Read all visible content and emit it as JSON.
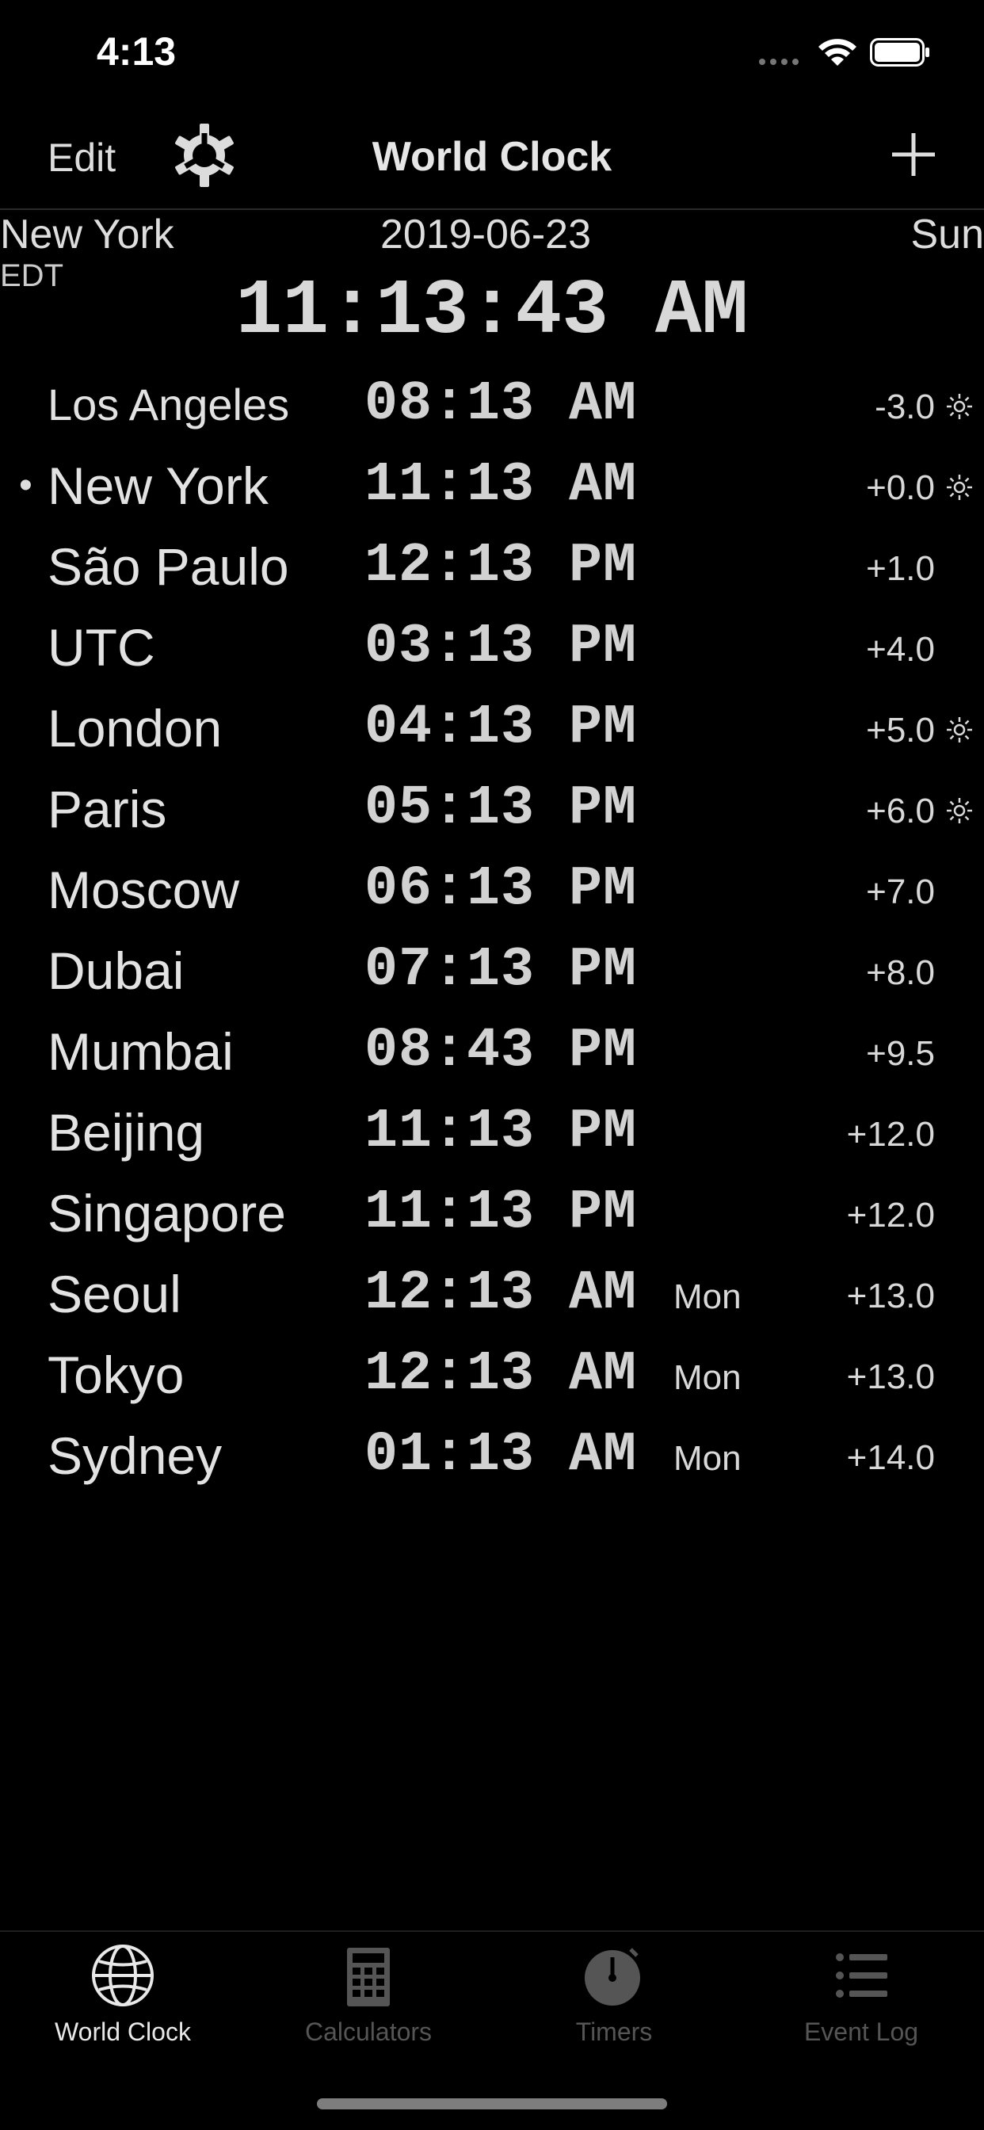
{
  "status_bar": {
    "time": "4:13"
  },
  "nav": {
    "edit_label": "Edit",
    "title": "World Clock",
    "settings_icon": "gear-icon",
    "add_icon": "plus-icon"
  },
  "header": {
    "city": "New York",
    "timezone": "EDT",
    "date": "2019-06-23",
    "day": "Sun",
    "clock": "11:13:43 AM"
  },
  "rows": [
    {
      "city": "Los Angeles",
      "time": "08:13 AM",
      "day": "",
      "offset": "-3.0",
      "sun": true,
      "current": false,
      "small": true
    },
    {
      "city": "New York",
      "time": "11:13 AM",
      "day": "",
      "offset": "+0.0",
      "sun": true,
      "current": true,
      "small": false
    },
    {
      "city": "São Paulo",
      "time": "12:13 PM",
      "day": "",
      "offset": "+1.0",
      "sun": false,
      "current": false,
      "small": false
    },
    {
      "city": "UTC",
      "time": "03:13 PM",
      "day": "",
      "offset": "+4.0",
      "sun": false,
      "current": false,
      "small": false
    },
    {
      "city": "London",
      "time": "04:13 PM",
      "day": "",
      "offset": "+5.0",
      "sun": true,
      "current": false,
      "small": false
    },
    {
      "city": "Paris",
      "time": "05:13 PM",
      "day": "",
      "offset": "+6.0",
      "sun": true,
      "current": false,
      "small": false
    },
    {
      "city": "Moscow",
      "time": "06:13 PM",
      "day": "",
      "offset": "+7.0",
      "sun": false,
      "current": false,
      "small": false
    },
    {
      "city": "Dubai",
      "time": "07:13 PM",
      "day": "",
      "offset": "+8.0",
      "sun": false,
      "current": false,
      "small": false
    },
    {
      "city": "Mumbai",
      "time": "08:43 PM",
      "day": "",
      "offset": "+9.5",
      "sun": false,
      "current": false,
      "small": false
    },
    {
      "city": "Beijing",
      "time": "11:13 PM",
      "day": "",
      "offset": "+12.0",
      "sun": false,
      "current": false,
      "small": false
    },
    {
      "city": "Singapore",
      "time": "11:13 PM",
      "day": "",
      "offset": "+12.0",
      "sun": false,
      "current": false,
      "small": false
    },
    {
      "city": "Seoul",
      "time": "12:13 AM",
      "day": "Mon",
      "offset": "+13.0",
      "sun": false,
      "current": false,
      "small": false
    },
    {
      "city": "Tokyo",
      "time": "12:13 AM",
      "day": "Mon",
      "offset": "+13.0",
      "sun": false,
      "current": false,
      "small": false
    },
    {
      "city": "Sydney",
      "time": "01:13 AM",
      "day": "Mon",
      "offset": "+14.0",
      "sun": false,
      "current": false,
      "small": false
    }
  ],
  "tabs": [
    {
      "label": "World Clock",
      "icon": "globe-icon",
      "active": true
    },
    {
      "label": "Calculators",
      "icon": "calculator-icon",
      "active": false
    },
    {
      "label": "Timers",
      "icon": "stopwatch-icon",
      "active": false
    },
    {
      "label": "Event Log",
      "icon": "list-icon",
      "active": false
    }
  ],
  "colors": {
    "background": "#000000",
    "text": "#e2e2e2",
    "inactive_tab": "#555555"
  }
}
